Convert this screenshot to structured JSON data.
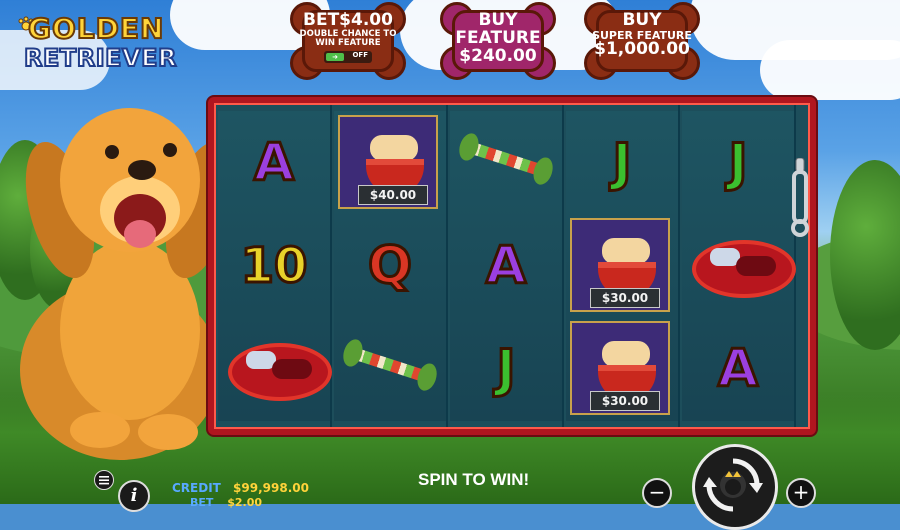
{
  "logo": {
    "line1": "GOLDEN",
    "line2": "RETRIEVER"
  },
  "buttons": {
    "bet": {
      "line1": "BET$4.00",
      "line2": "DOUBLE CHANCE TO",
      "line3": "WIN FEATURE",
      "toggle": "OFF"
    },
    "buy_feature": {
      "line1": "BUY",
      "line2": "FEATURE",
      "price": "$240.00"
    },
    "buy_super": {
      "line1": "BUY",
      "line2": "SUPER FEATURE",
      "price": "$1,000.00"
    }
  },
  "reels": [
    [
      {
        "type": "letter",
        "value": "A"
      },
      {
        "type": "letter",
        "value": "10"
      },
      {
        "type": "bed"
      }
    ],
    [
      {
        "type": "bowl",
        "prize": "$40.00"
      },
      {
        "type": "letter",
        "value": "Q"
      },
      {
        "type": "toy"
      }
    ],
    [
      {
        "type": "toy"
      },
      {
        "type": "letter",
        "value": "A"
      },
      {
        "type": "letter",
        "value": "J"
      }
    ],
    [
      {
        "type": "letter",
        "value": "J"
      },
      {
        "type": "bowl",
        "prize": "$30.00"
      },
      {
        "type": "bowl",
        "prize": "$30.00"
      }
    ],
    [
      {
        "type": "letter",
        "value": "J"
      },
      {
        "type": "bed"
      },
      {
        "type": "letter",
        "value": "A"
      }
    ]
  ],
  "footer": {
    "credit_label": "CREDIT",
    "credit_value": "$99,998.00",
    "bet_label": "BET",
    "bet_value": "$2.00",
    "spin_to_win": "SPIN TO WIN!",
    "minus": "−",
    "plus": "+",
    "info": "i"
  },
  "colors": {
    "frame": "#b0161f",
    "credit_label": "#58a9ff",
    "credit_value": "#ffd33a"
  }
}
